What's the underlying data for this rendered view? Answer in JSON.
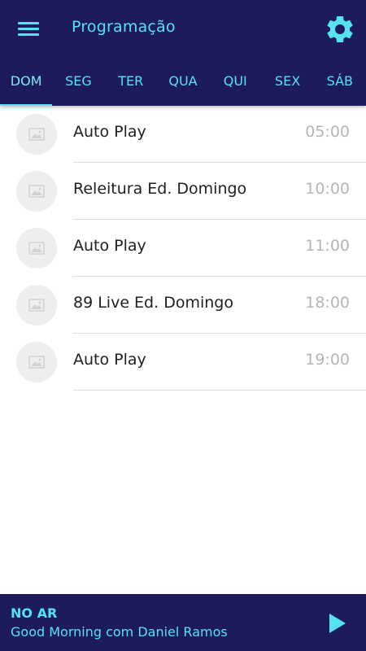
{
  "header": {
    "title": "Programação",
    "accent_color": "#56e2ee",
    "background_color": "#1d1b5c",
    "menu_icon": "menu-icon",
    "settings_icon": "gear-icon"
  },
  "tabs": [
    {
      "label": "DOM",
      "active": true
    },
    {
      "label": "SEG",
      "active": false
    },
    {
      "label": "TER",
      "active": false
    },
    {
      "label": "QUA",
      "active": false
    },
    {
      "label": "QUI",
      "active": false
    },
    {
      "label": "SEX",
      "active": false
    },
    {
      "label": "SÁB",
      "active": false
    }
  ],
  "schedule": [
    {
      "name": "Auto Play",
      "time": "05:00",
      "thumb_icon": "image-placeholder-icon"
    },
    {
      "name": "Releitura Ed. Domingo",
      "time": "10:00",
      "thumb_icon": "image-placeholder-icon"
    },
    {
      "name": "Auto Play",
      "time": "11:00",
      "thumb_icon": "image-placeholder-icon"
    },
    {
      "name": "89 Live Ed. Domingo",
      "time": "18:00",
      "thumb_icon": "image-placeholder-icon"
    },
    {
      "name": "Auto Play",
      "time": "19:00",
      "thumb_icon": "image-placeholder-icon"
    }
  ],
  "player": {
    "status_label": "NO AR",
    "program_name": "Good Morning com Daniel Ramos",
    "play_icon": "play-icon"
  }
}
